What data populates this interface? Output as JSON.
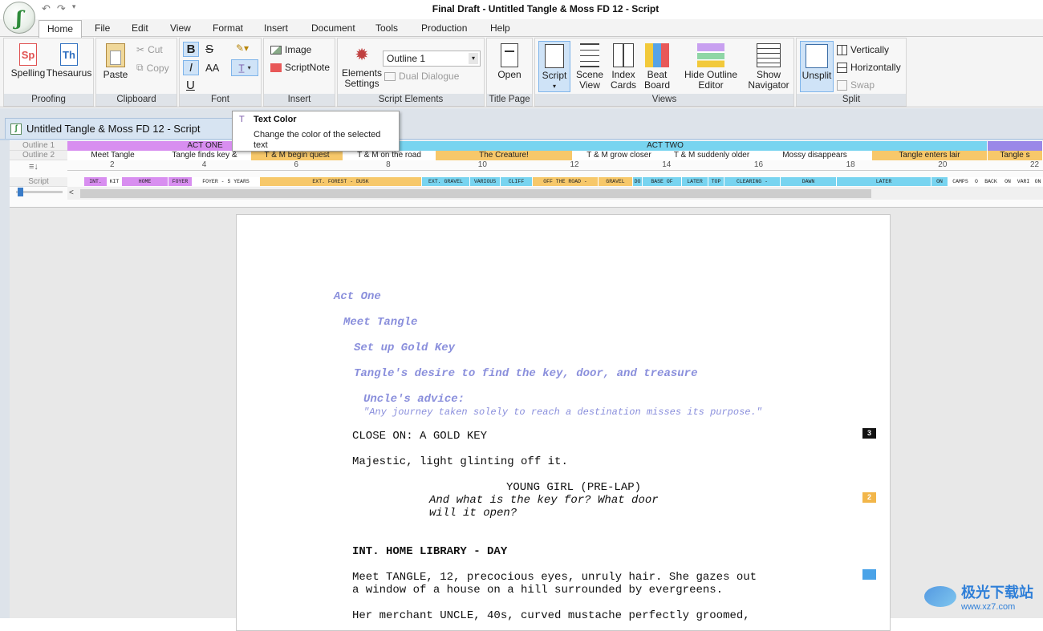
{
  "window": {
    "title": "Final Draft - Untitled Tangle & Moss FD 12 - Script",
    "app_logo_icon": "final-draft-logo"
  },
  "menu": {
    "tabs": [
      "Home",
      "File",
      "Edit",
      "View",
      "Format",
      "Insert",
      "Document",
      "Tools",
      "Production",
      "Help"
    ],
    "active": "Home"
  },
  "ribbon": {
    "proofing": {
      "label": "Proofing",
      "spelling": "Spelling",
      "thesaurus": "Thesaurus"
    },
    "clipboard": {
      "label": "Clipboard",
      "paste": "Paste",
      "cut": "Cut",
      "copy": "Copy"
    },
    "font": {
      "label": "Font",
      "bold": "B",
      "strike": "S",
      "italic": "I",
      "size": "AA",
      "underline": "U"
    },
    "insert": {
      "label": "Insert",
      "image": "Image",
      "scriptnote": "ScriptNote"
    },
    "script_elements": {
      "label": "Script Elements",
      "settings": "Elements Settings",
      "outline_select": "Outline 1",
      "dual_dialogue": "Dual Dialogue"
    },
    "title_page": {
      "label": "Title Page",
      "open": "Open"
    },
    "views": {
      "label": "Views",
      "script": "Script",
      "scene_view": "Scene View",
      "index_cards": "Index Cards",
      "beat_board": "Beat Board",
      "hide_outline": "Hide Outline Editor",
      "show_navigator": "Show Navigator"
    },
    "split": {
      "label": "Split",
      "unsplit": "Unsplit",
      "vertically": "Vertically",
      "horizontally": "Horizontally",
      "swap": "Swap"
    }
  },
  "tooltip": {
    "title": "Text Color",
    "body": "Change the color of the selected text"
  },
  "document_tab": {
    "title": "Untitled Tangle & Moss FD 12 - Script"
  },
  "outline": {
    "row_labels": [
      "Outline 1",
      "Outline 2",
      "Script"
    ],
    "outline1": [
      {
        "text": "ACT ONE",
        "color": "#d88ef0"
      },
      {
        "text": "ACT TWO",
        "color": "#78d4f0"
      },
      {
        "text": "",
        "color": "#9a88e8"
      }
    ],
    "outline2": [
      {
        "text": "Meet Tangle",
        "color": "#ffffff"
      },
      {
        "text": "Tangle finds key &",
        "color": "#ffffff"
      },
      {
        "text": "T & M begin quest",
        "color": "#f7c86a"
      },
      {
        "text": "T & M on the road",
        "color": "#ffffff"
      },
      {
        "text": "The Creature!",
        "color": "#f7c86a"
      },
      {
        "text": "T & M grow closer",
        "color": "#ffffff"
      },
      {
        "text": "T & M suddenly older",
        "color": "#ffffff"
      },
      {
        "text": "Mossy disappears",
        "color": "#ffffff"
      },
      {
        "text": "Tangle enters lair",
        "color": "#f7c86a"
      },
      {
        "text": "Tangle s",
        "color": "#f7c86a"
      }
    ],
    "ticks": [
      "2",
      "4",
      "6",
      "8",
      "10",
      "12",
      "14",
      "16",
      "18",
      "20",
      "22"
    ],
    "scenes": [
      {
        "text": "INT.",
        "color": "#d88ef0"
      },
      {
        "text": "KIT",
        "color": "#ffffff"
      },
      {
        "text": "HOME",
        "color": "#d88ef0"
      },
      {
        "text": "FOYER",
        "color": "#d88ef0"
      },
      {
        "text": "FOYER - 5 YEARS",
        "color": "#ffffff"
      },
      {
        "text": "EXT. FOREST - DUSK",
        "color": "#f7c86a"
      },
      {
        "text": "EXT. GRAVEL",
        "color": "#78d4f0"
      },
      {
        "text": "VARIOUS",
        "color": "#78d4f0"
      },
      {
        "text": "CLIFF",
        "color": "#78d4f0"
      },
      {
        "text": "OFF THE ROAD -",
        "color": "#f7c86a"
      },
      {
        "text": "GRAVEL",
        "color": "#f7c86a"
      },
      {
        "text": "DO",
        "color": "#78d4f0"
      },
      {
        "text": "BASE OF",
        "color": "#78d4f0"
      },
      {
        "text": "LATER",
        "color": "#78d4f0"
      },
      {
        "text": "TOP",
        "color": "#78d4f0"
      },
      {
        "text": "CLEARING -",
        "color": "#78d4f0"
      },
      {
        "text": "DAWN",
        "color": "#78d4f0"
      },
      {
        "text": "LATER",
        "color": "#78d4f0"
      },
      {
        "text": "ON",
        "color": "#78d4f0"
      },
      {
        "text": "CAMPS",
        "color": "#ffffff"
      },
      {
        "text": "O",
        "color": "#ffffff"
      },
      {
        "text": "BACK",
        "color": "#ffffff"
      },
      {
        "text": "ON",
        "color": "#ffffff"
      },
      {
        "text": "VARI",
        "color": "#ffffff"
      },
      {
        "text": "ON",
        "color": "#ffffff"
      }
    ]
  },
  "script": {
    "outline_elements": [
      "Act One",
      "Meet Tangle",
      "Set up Gold Key",
      "Tangle's desire to find the key, door, and treasure",
      "Uncle's advice:"
    ],
    "quote": "\"Any journey taken solely to reach a destination misses its purpose.\"",
    "action1": "CLOSE ON: A GOLD KEY",
    "action2": "Majestic, light glinting off it.",
    "character": "YOUNG GIRL (PRE-LAP)",
    "dialogue1": "And what is the key for? What door",
    "dialogue2": "will it open?",
    "scene_heading": "INT. HOME LIBRARY - DAY",
    "action3a": "Meet TANGLE, 12, precocious eyes, unruly hair. She gazes out",
    "action3b": "a window of a house on a hill surrounded by evergreens.",
    "action4": "Her merchant UNCLE, 40s, curved mustache perfectly groomed,",
    "markers": [
      "3",
      "2"
    ]
  },
  "watermark": {
    "text": "极光下载站",
    "url": "www.xz7.com"
  }
}
